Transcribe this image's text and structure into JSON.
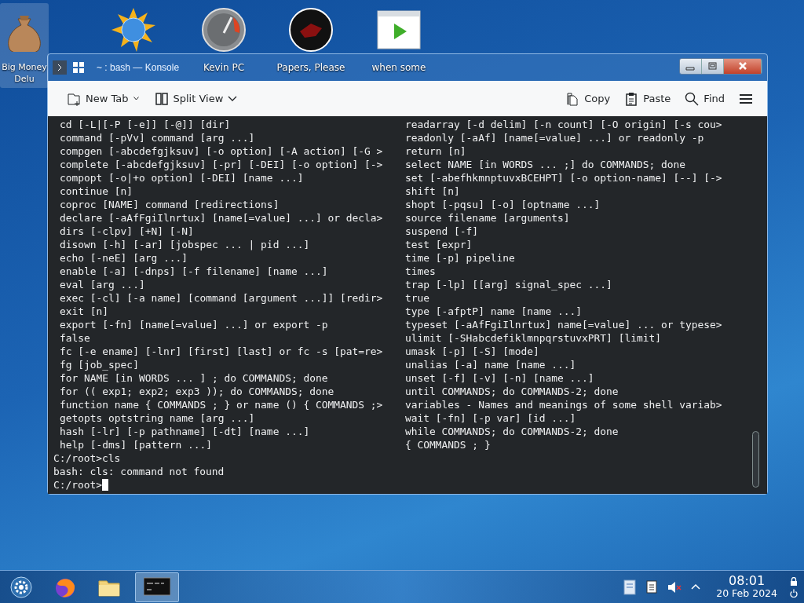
{
  "desktop_icons": [
    {
      "kind": "money",
      "label": "Big Money Delu",
      "selected": true
    },
    {
      "kind": "weather",
      "selected": false
    },
    {
      "kind": "gauge",
      "label": "Kevin PC",
      "selected": false
    },
    {
      "kind": "game",
      "label": "Papers, Please",
      "selected": false
    },
    {
      "kind": "video",
      "label": "when some",
      "selected": false
    }
  ],
  "window": {
    "title": "~ : bash — Konsole",
    "toolbar_left": [
      {
        "kind": "newtab",
        "label": "New Tab"
      },
      {
        "kind": "split",
        "label": "Split View"
      }
    ],
    "toolbar_right": [
      {
        "kind": "copy",
        "label": "Copy"
      },
      {
        "kind": "paste",
        "label": "Paste"
      },
      {
        "kind": "find",
        "label": "Find"
      },
      {
        "kind": "menu"
      }
    ],
    "terminal": {
      "left_column": [
        "cd [-L|[-P [-e]] [-@]] [dir]",
        "command [-pVv] command [arg ...]",
        "compgen [-abcdefgjksuv] [-o option] [-A action] [-G >",
        "complete [-abcdefgjksuv] [-pr] [-DEI] [-o option] [->",
        "compopt [-o|+o option] [-DEI] [name ...]",
        "continue [n]",
        "coproc [NAME] command [redirections]",
        "declare [-aAfFgiIlnrtux] [name[=value] ...] or decla>",
        "dirs [-clpv] [+N] [-N]",
        "disown [-h] [-ar] [jobspec ... | pid ...]",
        "echo [-neE] [arg ...]",
        "enable [-a] [-dnps] [-f filename] [name ...]",
        "eval [arg ...]",
        "exec [-cl] [-a name] [command [argument ...]] [redir>",
        "exit [n]",
        "export [-fn] [name[=value] ...] or export -p",
        "false",
        "fc [-e ename] [-lnr] [first] [last] or fc -s [pat=re>",
        "fg [job_spec]",
        "for NAME [in WORDS ... ] ; do COMMANDS; done",
        "for (( exp1; exp2; exp3 )); do COMMANDS; done",
        "function name { COMMANDS ; } or name () { COMMANDS ;>",
        "getopts optstring name [arg ...]",
        "hash [-lr] [-p pathname] [-dt] [name ...]",
        "help [-dms] [pattern ...]"
      ],
      "right_column": [
        "readarray [-d delim] [-n count] [-O origin] [-s cou>",
        "readonly [-aAf] [name[=value] ...] or readonly -p",
        "return [n]",
        "select NAME [in WORDS ... ;] do COMMANDS; done",
        "set [-abefhkmnptuvxBCEHPT] [-o option-name] [--] [->",
        "shift [n]",
        "shopt [-pqsu] [-o] [optname ...]",
        "source filename [arguments]",
        "suspend [-f]",
        "test [expr]",
        "time [-p] pipeline",
        "times",
        "trap [-lp] [[arg] signal_spec ...]",
        "true",
        "type [-afptP] name [name ...]",
        "typeset [-aAfFgiIlnrtux] name[=value] ... or typese>",
        "ulimit [-SHabcdefiklmnpqrstuvxPRT] [limit]",
        "umask [-p] [-S] [mode]",
        "unalias [-a] name [name ...]",
        "unset [-f] [-v] [-n] [name ...]",
        "until COMMANDS; do COMMANDS-2; done",
        "variables - Names and meanings of some shell variab>",
        "wait [-fn] [-p var] [id ...]",
        "while COMMANDS; do COMMANDS-2; done",
        "{ COMMANDS ; }"
      ],
      "lines": [
        "C:/root>cls",
        "bash: cls: command not found"
      ],
      "prompt": "C:/root>"
    }
  },
  "taskbar": {
    "tasks": [
      {
        "kind": "launcher",
        "selected": false
      },
      {
        "kind": "browser",
        "selected": false
      },
      {
        "kind": "files",
        "selected": false
      },
      {
        "kind": "terminal",
        "selected": true
      }
    ],
    "clock": {
      "time": "08:01",
      "date": "20 Feb 2024"
    }
  }
}
